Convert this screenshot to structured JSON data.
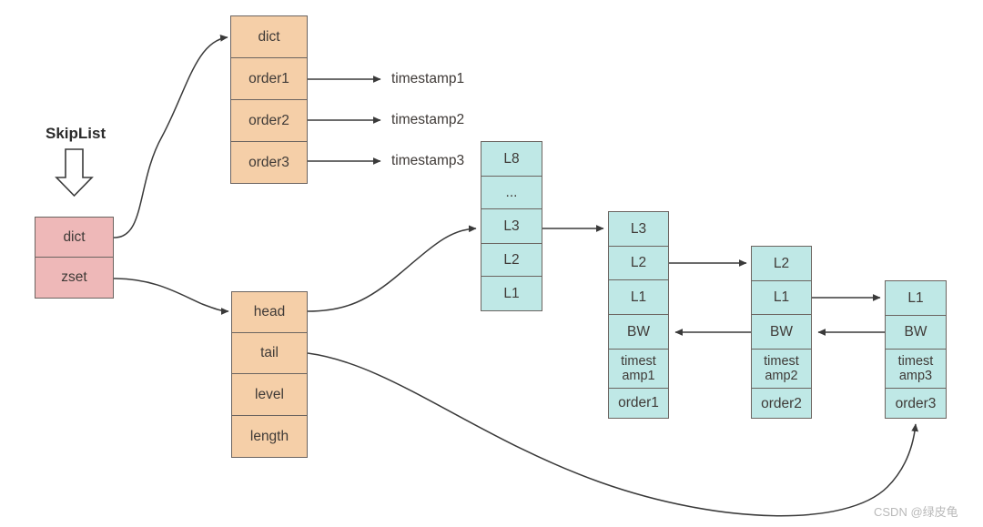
{
  "diagram": {
    "title": "SkipList",
    "watermark": "CSDN @绿皮龟",
    "colors": {
      "pink": "#eeb8b8",
      "orange": "#f5cfa8",
      "cyan": "#bfe8e6",
      "stroke": "#6b6460",
      "arrow": "#3a3a3a",
      "text": "#3f3a37"
    },
    "root_struct": {
      "name": "skiplist-root",
      "cells": [
        "dict",
        "zset"
      ]
    },
    "dict_struct": {
      "name": "dict-table",
      "cells": [
        "dict",
        "order1",
        "order2",
        "order3"
      ]
    },
    "dict_values": [
      "timestamp1",
      "timestamp2",
      "timestamp3"
    ],
    "zset_struct": {
      "name": "zskiplist-header",
      "cells": [
        "head",
        "tail",
        "level",
        "length"
      ]
    },
    "skiplist_head": {
      "name": "skiplist-head-node",
      "cells": [
        "L8",
        "...",
        "L3",
        "L2",
        "L1"
      ]
    },
    "skiplist_nodes": [
      {
        "name": "skiplist-node-1",
        "cells": [
          "L3",
          "L2",
          "L1",
          "BW",
          "timest\namp1",
          "order1"
        ]
      },
      {
        "name": "skiplist-node-2",
        "cells": [
          "L2",
          "L1",
          "BW",
          "timest\namp2",
          "order2"
        ]
      },
      {
        "name": "skiplist-node-3",
        "cells": [
          "L1",
          "BW",
          "timest\namp3",
          "order3"
        ]
      }
    ]
  }
}
